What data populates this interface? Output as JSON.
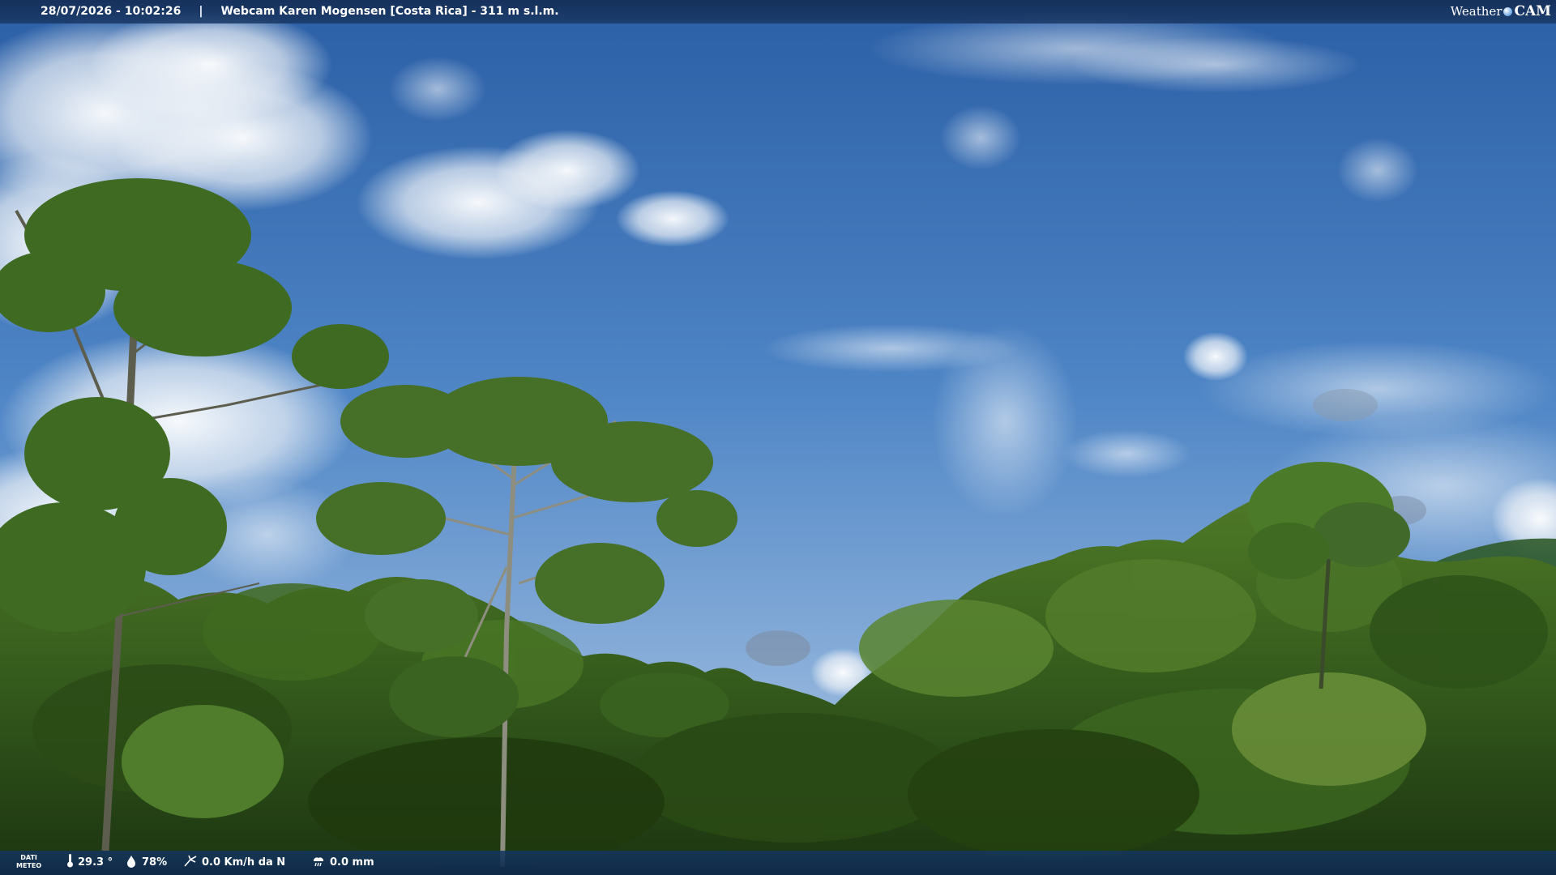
{
  "overlay_top": {
    "timestamp": "28/07/2026 - 10:02:26",
    "separator": "|",
    "caption": "Webcam Karen Mogensen [Costa Rica] - 311 m s.l.m.",
    "brand_weather": "Weather",
    "brand_cam": "CAM"
  },
  "overlay_bottom": {
    "label_line1": "DATI",
    "label_line2": "METEO",
    "temperature": "29.3 °",
    "humidity": "78%",
    "wind": "0.0 Km/h da N",
    "rain": "0.0 mm"
  },
  "icons": {
    "temperature": "thermometer-icon",
    "humidity": "droplet-icon",
    "wind": "wind-icon",
    "rain": "rain-cloud-icon",
    "brand": "globe-icon"
  },
  "colors": {
    "sky_top": "#2d62a8",
    "sky_bottom": "#9fc0de",
    "foliage_dark": "#1f3b14",
    "foliage_light": "#5f8a2c",
    "overlay_bar": "#17365e"
  }
}
